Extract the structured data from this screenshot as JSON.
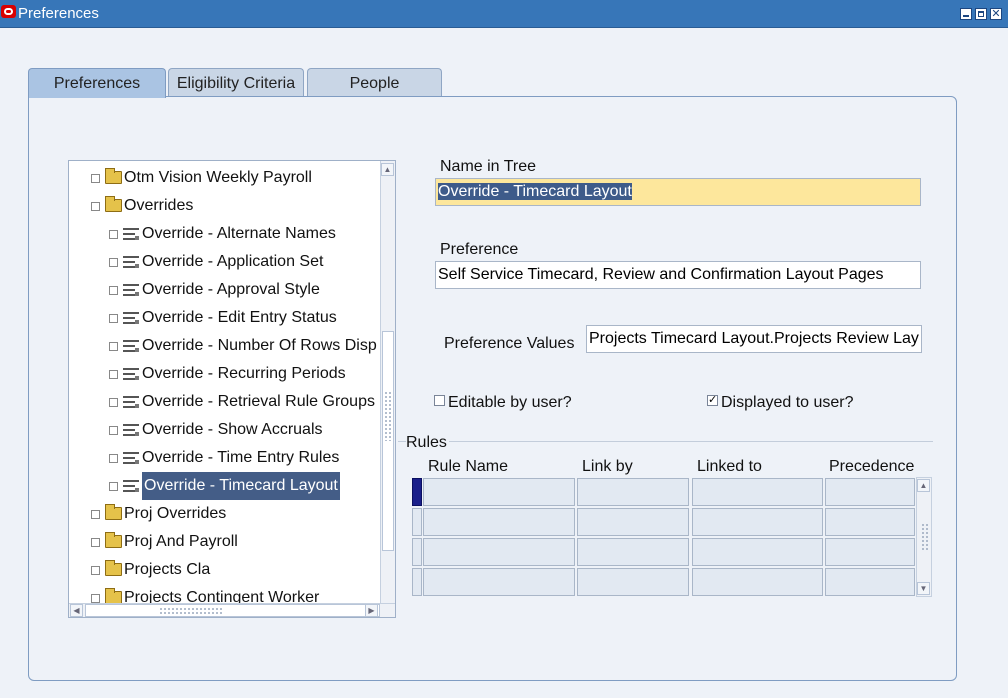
{
  "window": {
    "title": "Preferences",
    "minimize_icon": "minimize-icon",
    "maximize_icon": "maximize-icon",
    "close_icon": "close-icon"
  },
  "tabs": [
    {
      "label": "Preferences",
      "active": true
    },
    {
      "label": "Eligibility Criteria",
      "active": false
    },
    {
      "label": "People",
      "active": false
    }
  ],
  "tree": {
    "items": [
      {
        "label": "Otm Vision Weekly Payroll",
        "type": "folder",
        "level": 0
      },
      {
        "label": "Overrides",
        "type": "folder",
        "level": 0,
        "expanded": true
      },
      {
        "label": "Override - Alternate Names",
        "type": "preference",
        "level": 1
      },
      {
        "label": "Override - Application Set",
        "type": "preference",
        "level": 1
      },
      {
        "label": "Override - Approval Style",
        "type": "preference",
        "level": 1
      },
      {
        "label": "Override - Edit Entry Status",
        "type": "preference",
        "level": 1
      },
      {
        "label": "Override - Number Of Rows Disp",
        "type": "preference",
        "level": 1
      },
      {
        "label": "Override - Recurring Periods",
        "type": "preference",
        "level": 1
      },
      {
        "label": "Override - Retrieval Rule Groups",
        "type": "preference",
        "level": 1
      },
      {
        "label": "Override - Show Accruals",
        "type": "preference",
        "level": 1
      },
      {
        "label": "Override - Time Entry Rules",
        "type": "preference",
        "level": 1
      },
      {
        "label": "Override - Timecard Layout",
        "type": "preference",
        "level": 1,
        "selected": true
      },
      {
        "label": "Proj Overrides",
        "type": "folder",
        "level": 0
      },
      {
        "label": "Proj And Payroll",
        "type": "folder",
        "level": 0
      },
      {
        "label": "Projects Cla",
        "type": "folder",
        "level": 0
      },
      {
        "label": "Projects Contingent Worker",
        "type": "folder",
        "level": 0
      }
    ]
  },
  "form": {
    "name_in_tree_label": "Name in Tree",
    "name_in_tree_value": "Override - Timecard Layout",
    "preference_label": "Preference",
    "preference_value": "Self Service Timecard, Review and Confirmation Layout Pages",
    "preference_values_label": "Preference Values",
    "preference_values_value": "Projects Timecard Layout.Projects Review Lay",
    "editable_label": "Editable by user?",
    "editable_checked": false,
    "displayed_label": "Displayed to user?",
    "displayed_checked": true
  },
  "rules": {
    "title": "Rules",
    "columns": [
      "Rule Name",
      "Link by",
      "Linked to",
      "Precedence"
    ],
    "rows": [
      [
        "",
        "",
        "",
        ""
      ],
      [
        "",
        "",
        "",
        ""
      ],
      [
        "",
        "",
        "",
        ""
      ],
      [
        "",
        "",
        "",
        ""
      ]
    ]
  },
  "colors": {
    "titlebar": "#3776b8",
    "selection": "#445d87",
    "required_field": "#fde79c"
  }
}
